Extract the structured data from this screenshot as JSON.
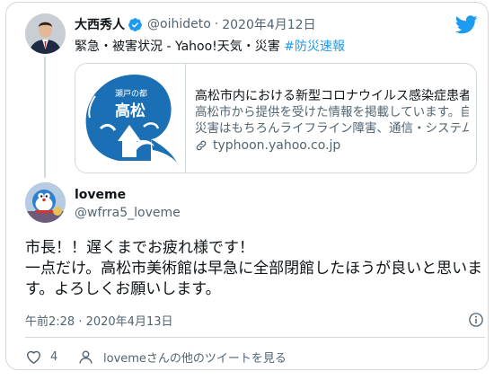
{
  "parent_tweet": {
    "author_name": "大西秀人",
    "handle": "@oihideto",
    "separator": "·",
    "date": "2020年4月12日",
    "text_prefix": "緊急・被害状況 - Yahoo!天気・災害 ",
    "hashtag": "#防災速報",
    "link_card": {
      "logo_text_small": "瀬戸の都",
      "logo_text_large": "高松",
      "title": "高松市内における新型コロナウイルス感染症患者（...",
      "description_line1": "高松市から提供を受けた情報を掲載しています。自然",
      "description_line2": "災害はもちろんライフライン障害、通信・システム障害...",
      "domain": "typhoon.yahoo.co.jp"
    }
  },
  "reply_tweet": {
    "author_name": "loveme",
    "handle": "@wfrra5_loveme",
    "text_line1": "市長！！遅くまでお疲れ様です！",
    "text_line2": "一点だけ。高松市美術館は早急に全部閉館したほうが良いと思いま",
    "text_line3": "す。よろしくお願いします。",
    "timestamp": "午前2:28 · 2020年4月13日",
    "like_count": "4",
    "more_tweets_label": "lovemeさんの他のツイートを見る"
  },
  "colors": {
    "twitter_blue": "#1d9bf0",
    "text_primary": "#0f1419",
    "text_secondary": "#536471",
    "border": "#cfd9de",
    "logo_blue": "#1a6fb5"
  },
  "icons": [
    "verified-badge-icon",
    "twitter-logo-icon",
    "link-icon",
    "info-icon",
    "heart-icon",
    "person-icon"
  ]
}
